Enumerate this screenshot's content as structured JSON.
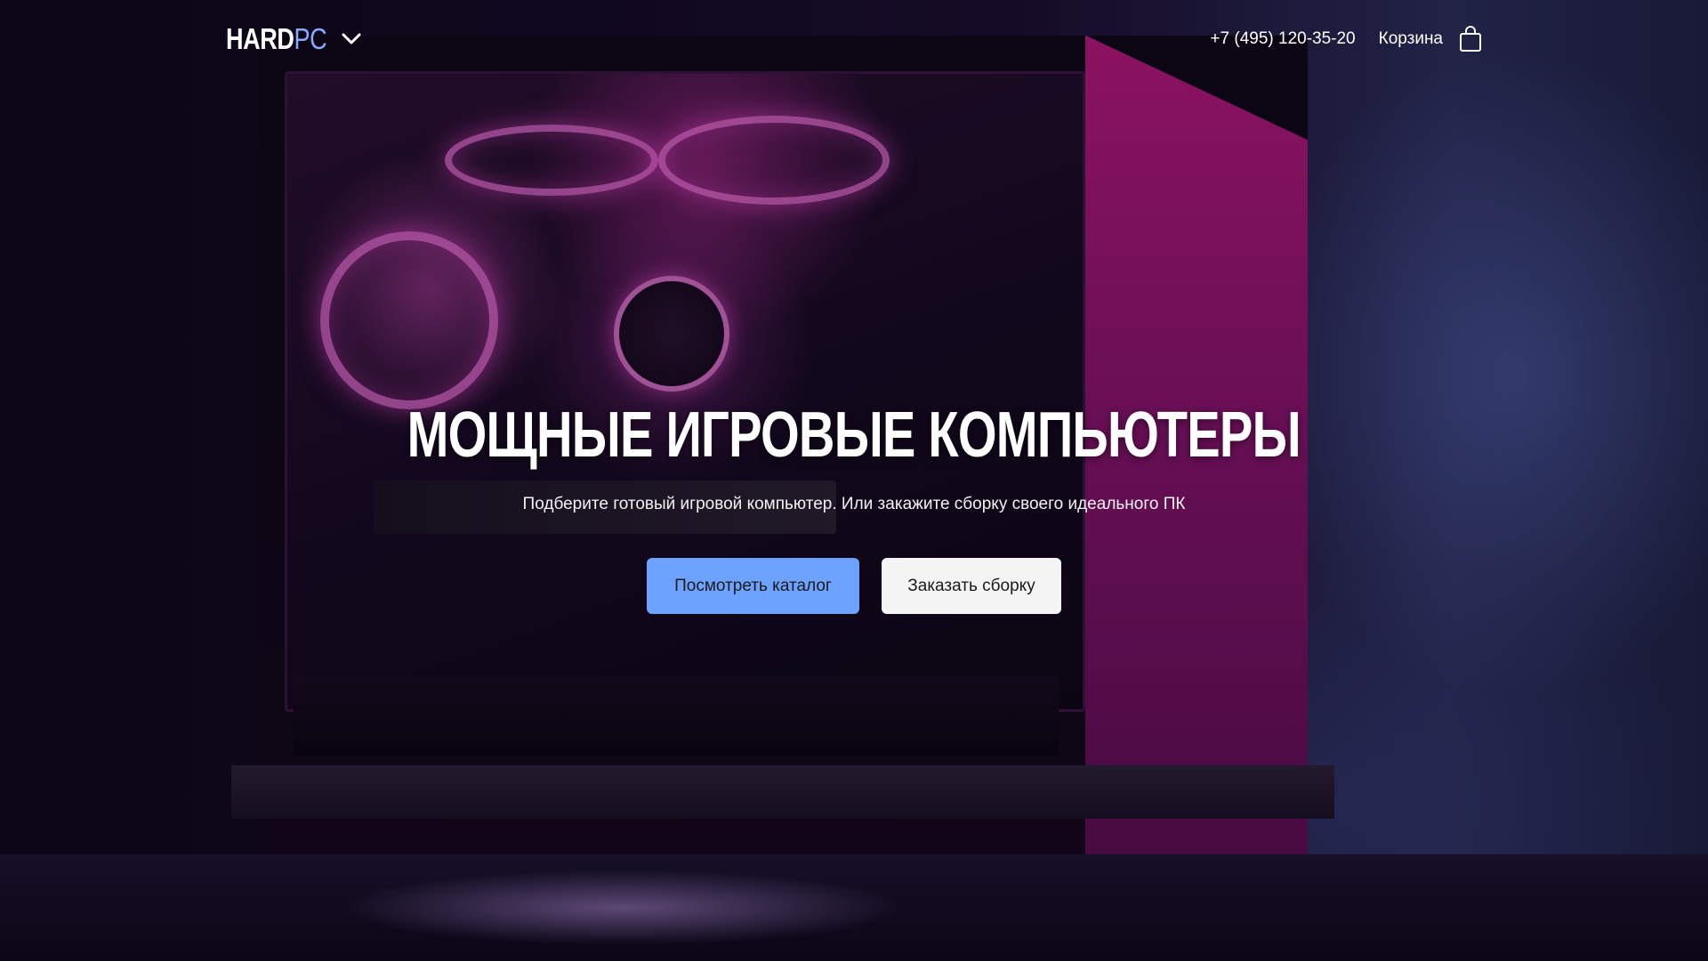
{
  "header": {
    "logo_primary": "HARD",
    "logo_secondary": "PC",
    "phone": "+7 (495) 120-35-20",
    "cart_label": "Корзина"
  },
  "hero": {
    "title": "МОЩНЫЕ ИГРОВЫЕ КОМПЬЮТЕРЫ",
    "subtitle": "Подберите готовый игровой компьютер. Или закажите сборку своего идеального ПК",
    "primary_button": "Посмотреть каталог",
    "secondary_button": "Заказать сборку"
  },
  "icons": {
    "logo_dropdown": "chevron-down-icon",
    "cart": "shopping-bag-icon"
  },
  "colors": {
    "accent": "#6ea2ff",
    "logo_accent": "#8aa8ff",
    "secondary_button_bg": "#f4f4f4",
    "text": "#ffffff"
  }
}
